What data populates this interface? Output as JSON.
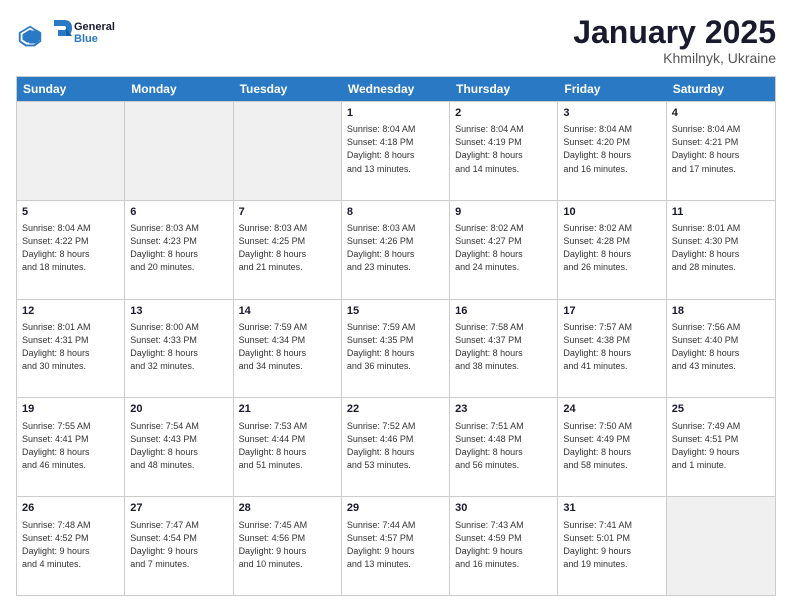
{
  "logo": {
    "line1": "General",
    "line2": "Blue"
  },
  "title": "January 2025",
  "subtitle": "Khmilnyk, Ukraine",
  "days": [
    "Sunday",
    "Monday",
    "Tuesday",
    "Wednesday",
    "Thursday",
    "Friday",
    "Saturday"
  ],
  "rows": [
    [
      {
        "day": "",
        "info": ""
      },
      {
        "day": "",
        "info": ""
      },
      {
        "day": "",
        "info": ""
      },
      {
        "day": "1",
        "info": "Sunrise: 8:04 AM\nSunset: 4:18 PM\nDaylight: 8 hours\nand 13 minutes."
      },
      {
        "day": "2",
        "info": "Sunrise: 8:04 AM\nSunset: 4:19 PM\nDaylight: 8 hours\nand 14 minutes."
      },
      {
        "day": "3",
        "info": "Sunrise: 8:04 AM\nSunset: 4:20 PM\nDaylight: 8 hours\nand 16 minutes."
      },
      {
        "day": "4",
        "info": "Sunrise: 8:04 AM\nSunset: 4:21 PM\nDaylight: 8 hours\nand 17 minutes."
      }
    ],
    [
      {
        "day": "5",
        "info": "Sunrise: 8:04 AM\nSunset: 4:22 PM\nDaylight: 8 hours\nand 18 minutes."
      },
      {
        "day": "6",
        "info": "Sunrise: 8:03 AM\nSunset: 4:23 PM\nDaylight: 8 hours\nand 20 minutes."
      },
      {
        "day": "7",
        "info": "Sunrise: 8:03 AM\nSunset: 4:25 PM\nDaylight: 8 hours\nand 21 minutes."
      },
      {
        "day": "8",
        "info": "Sunrise: 8:03 AM\nSunset: 4:26 PM\nDaylight: 8 hours\nand 23 minutes."
      },
      {
        "day": "9",
        "info": "Sunrise: 8:02 AM\nSunset: 4:27 PM\nDaylight: 8 hours\nand 24 minutes."
      },
      {
        "day": "10",
        "info": "Sunrise: 8:02 AM\nSunset: 4:28 PM\nDaylight: 8 hours\nand 26 minutes."
      },
      {
        "day": "11",
        "info": "Sunrise: 8:01 AM\nSunset: 4:30 PM\nDaylight: 8 hours\nand 28 minutes."
      }
    ],
    [
      {
        "day": "12",
        "info": "Sunrise: 8:01 AM\nSunset: 4:31 PM\nDaylight: 8 hours\nand 30 minutes."
      },
      {
        "day": "13",
        "info": "Sunrise: 8:00 AM\nSunset: 4:33 PM\nDaylight: 8 hours\nand 32 minutes."
      },
      {
        "day": "14",
        "info": "Sunrise: 7:59 AM\nSunset: 4:34 PM\nDaylight: 8 hours\nand 34 minutes."
      },
      {
        "day": "15",
        "info": "Sunrise: 7:59 AM\nSunset: 4:35 PM\nDaylight: 8 hours\nand 36 minutes."
      },
      {
        "day": "16",
        "info": "Sunrise: 7:58 AM\nSunset: 4:37 PM\nDaylight: 8 hours\nand 38 minutes."
      },
      {
        "day": "17",
        "info": "Sunrise: 7:57 AM\nSunset: 4:38 PM\nDaylight: 8 hours\nand 41 minutes."
      },
      {
        "day": "18",
        "info": "Sunrise: 7:56 AM\nSunset: 4:40 PM\nDaylight: 8 hours\nand 43 minutes."
      }
    ],
    [
      {
        "day": "19",
        "info": "Sunrise: 7:55 AM\nSunset: 4:41 PM\nDaylight: 8 hours\nand 46 minutes."
      },
      {
        "day": "20",
        "info": "Sunrise: 7:54 AM\nSunset: 4:43 PM\nDaylight: 8 hours\nand 48 minutes."
      },
      {
        "day": "21",
        "info": "Sunrise: 7:53 AM\nSunset: 4:44 PM\nDaylight: 8 hours\nand 51 minutes."
      },
      {
        "day": "22",
        "info": "Sunrise: 7:52 AM\nSunset: 4:46 PM\nDaylight: 8 hours\nand 53 minutes."
      },
      {
        "day": "23",
        "info": "Sunrise: 7:51 AM\nSunset: 4:48 PM\nDaylight: 8 hours\nand 56 minutes."
      },
      {
        "day": "24",
        "info": "Sunrise: 7:50 AM\nSunset: 4:49 PM\nDaylight: 8 hours\nand 58 minutes."
      },
      {
        "day": "25",
        "info": "Sunrise: 7:49 AM\nSunset: 4:51 PM\nDaylight: 9 hours\nand 1 minute."
      }
    ],
    [
      {
        "day": "26",
        "info": "Sunrise: 7:48 AM\nSunset: 4:52 PM\nDaylight: 9 hours\nand 4 minutes."
      },
      {
        "day": "27",
        "info": "Sunrise: 7:47 AM\nSunset: 4:54 PM\nDaylight: 9 hours\nand 7 minutes."
      },
      {
        "day": "28",
        "info": "Sunrise: 7:45 AM\nSunset: 4:56 PM\nDaylight: 9 hours\nand 10 minutes."
      },
      {
        "day": "29",
        "info": "Sunrise: 7:44 AM\nSunset: 4:57 PM\nDaylight: 9 hours\nand 13 minutes."
      },
      {
        "day": "30",
        "info": "Sunrise: 7:43 AM\nSunset: 4:59 PM\nDaylight: 9 hours\nand 16 minutes."
      },
      {
        "day": "31",
        "info": "Sunrise: 7:41 AM\nSunset: 5:01 PM\nDaylight: 9 hours\nand 19 minutes."
      },
      {
        "day": "",
        "info": ""
      }
    ]
  ]
}
